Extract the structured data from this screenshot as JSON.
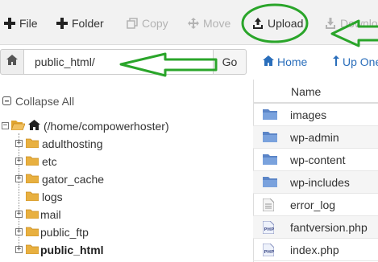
{
  "toolbar": {
    "file": "File",
    "folder": "Folder",
    "copy": "Copy",
    "move": "Move",
    "upload": "Upload",
    "download": "Download"
  },
  "address": {
    "path": "public_html/",
    "go": "Go"
  },
  "nav": {
    "home": "Home",
    "up": "Up One"
  },
  "tree": {
    "collapse_all": "Collapse All",
    "root": "(/home/compowerhoster)",
    "items": [
      "adulthosting",
      "etc",
      "gator_cache",
      "logs",
      "mail",
      "public_ftp",
      "public_html"
    ]
  },
  "files": {
    "header_name": "Name",
    "rows": [
      {
        "name": "images",
        "type": "folder"
      },
      {
        "name": "wp-admin",
        "type": "folder"
      },
      {
        "name": "wp-content",
        "type": "folder"
      },
      {
        "name": "wp-includes",
        "type": "folder"
      },
      {
        "name": "error_log",
        "type": "text"
      },
      {
        "name": "fantversion.php",
        "type": "php"
      },
      {
        "name": "index.php",
        "type": "php"
      }
    ]
  },
  "colors": {
    "link": "#2a6ebb",
    "folder_tree": "#e0a530",
    "folder_list": "#5b85c7",
    "annotation": "#2aa52a"
  }
}
